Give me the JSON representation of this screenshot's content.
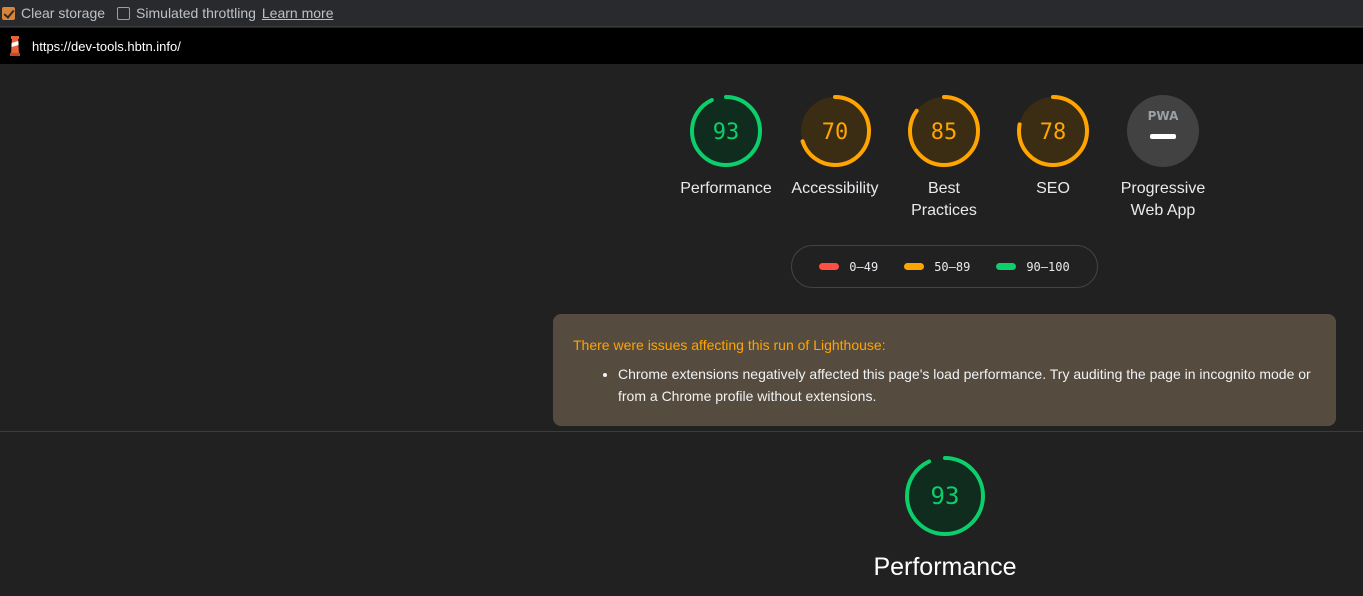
{
  "toolbar": {
    "clear_storage": {
      "label": "Clear storage",
      "checked": true
    },
    "simulated_throttling": {
      "label": "Simulated throttling",
      "checked": false
    },
    "learn_more": "Learn more"
  },
  "url": "https://dev-tools.hbtn.info/",
  "colors": {
    "pass": "#0cce6b",
    "average": "#ffa400",
    "fail": "#ff4e42",
    "pass_bg": "#0f2c1f",
    "average_bg": "#3b2d14",
    "pwa_bg": "#424242"
  },
  "categories": [
    {
      "key": "performance",
      "score": 93,
      "label": "Performance",
      "rating": "pass"
    },
    {
      "key": "accessibility",
      "score": 70,
      "label": "Accessibility",
      "rating": "average"
    },
    {
      "key": "best-practices",
      "score": 85,
      "label": "Best Practices",
      "rating": "average"
    },
    {
      "key": "seo",
      "score": 78,
      "label": "SEO",
      "rating": "average"
    }
  ],
  "pwa": {
    "label": "Progressive Web App",
    "badge_text": "PWA"
  },
  "legend": [
    {
      "range": "0–49",
      "rating": "fail"
    },
    {
      "range": "50–89",
      "rating": "average"
    },
    {
      "range": "90–100",
      "rating": "pass"
    }
  ],
  "warning": {
    "title": "There were issues affecting this run of Lighthouse:",
    "items": [
      "Chrome extensions negatively affected this page's load performance. Try auditing the page in incognito mode or from a Chrome profile without extensions."
    ]
  },
  "performance_section": {
    "score": 93,
    "label": "Performance",
    "rating": "pass"
  }
}
